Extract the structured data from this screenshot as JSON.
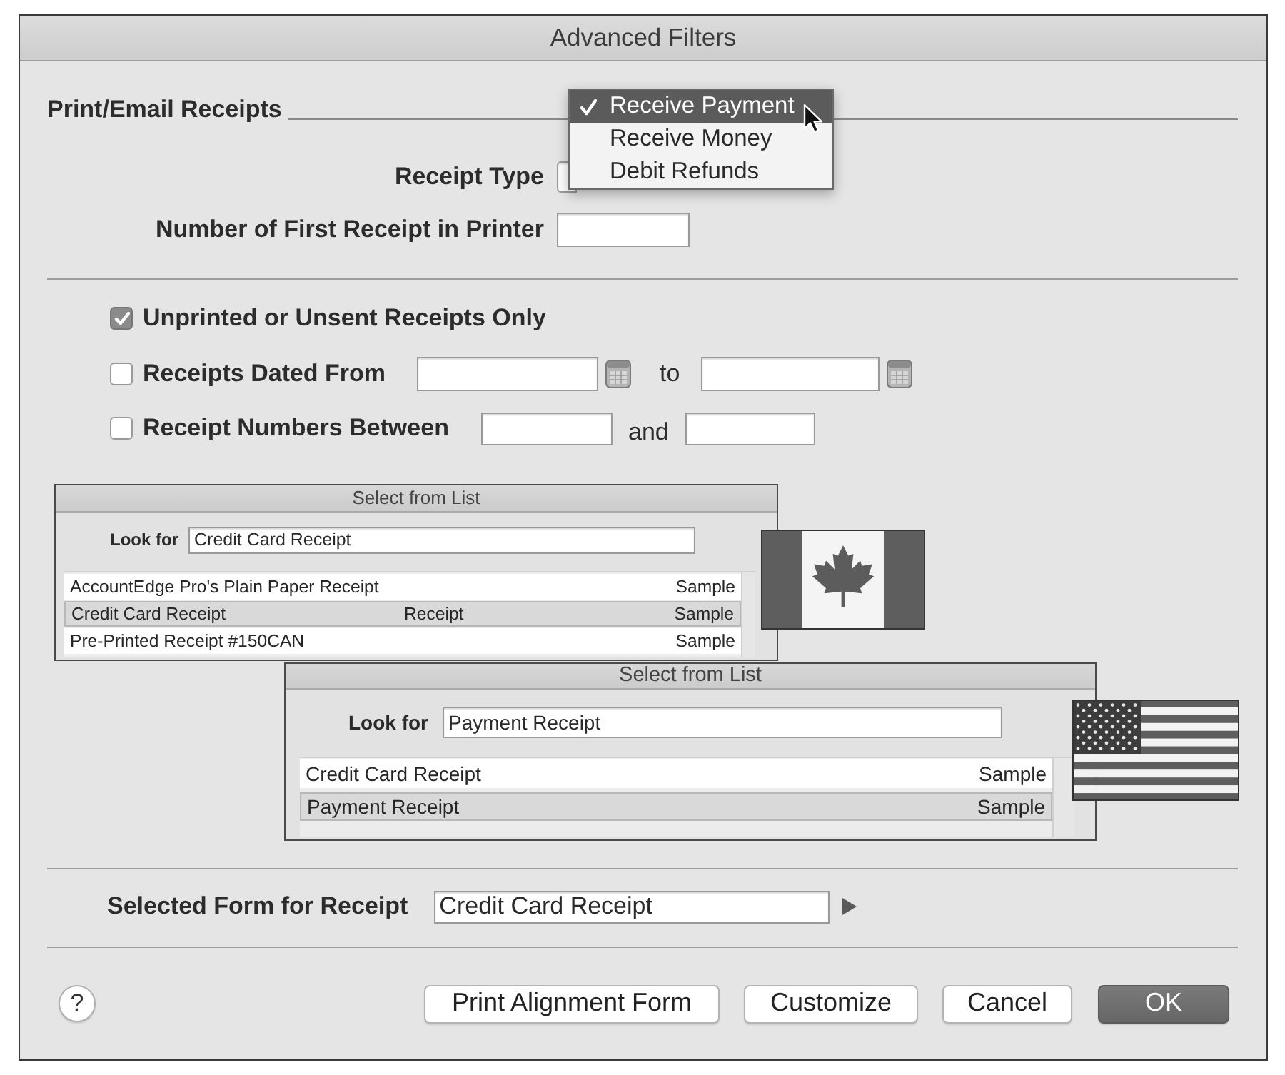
{
  "window": {
    "title": "Advanced Filters"
  },
  "print_email": {
    "heading": "Print/Email Receipts",
    "receipt_type_label": "Receipt Type",
    "receipt_type_menu": [
      {
        "label": "Receive Payment",
        "selected": true
      },
      {
        "label": "Receive Money",
        "selected": false
      },
      {
        "label": "Debit Refunds",
        "selected": false
      }
    ],
    "first_receipt_label": "Number of First Receipt in Printer"
  },
  "filters": [
    {
      "kind": "toggle",
      "label": "Unprinted or Unsent Receipts Only",
      "checked": true
    },
    {
      "kind": "date_range",
      "label": "Receipts Dated From",
      "joiner": "to",
      "checked": false
    },
    {
      "kind": "number_range",
      "label": "Receipt Numbers Between",
      "joiner": "and",
      "checked": false
    }
  ],
  "form_lists": [
    {
      "title": "Select from List",
      "look_for_label": "Look for",
      "look_for_value": "Credit Card Receipt",
      "rows": [
        {
          "column_1": "AccountEdge Pro's Plain Paper Receipt",
          "column_3": "Sample",
          "selected": false
        },
        {
          "column_1": "Credit Card Receipt",
          "column_2": "Receipt",
          "column_3": "Sample",
          "selected": true
        },
        {
          "column_1": "Pre-Printed Receipt #150CAN",
          "column_3": "Sample",
          "selected": false
        }
      ]
    },
    {
      "title": "Select from List",
      "look_for_label": "Look for",
      "look_for_value": "Payment Receipt",
      "rows": [
        {
          "column_1": "Credit Card Receipt",
          "column_3": "Sample",
          "selected": false
        },
        {
          "column_1": "Payment Receipt",
          "column_3": "Sample",
          "selected": true
        }
      ]
    }
  ],
  "selected_form": {
    "label": "Selected Form for Receipt",
    "value": "Credit Card Receipt"
  },
  "help_button": "?",
  "buttons": [
    {
      "label": "Print Alignment Form",
      "primary": false
    },
    {
      "label": "Customize",
      "primary": false
    },
    {
      "label": "Cancel",
      "primary": false
    },
    {
      "label": "OK",
      "primary": true
    }
  ]
}
